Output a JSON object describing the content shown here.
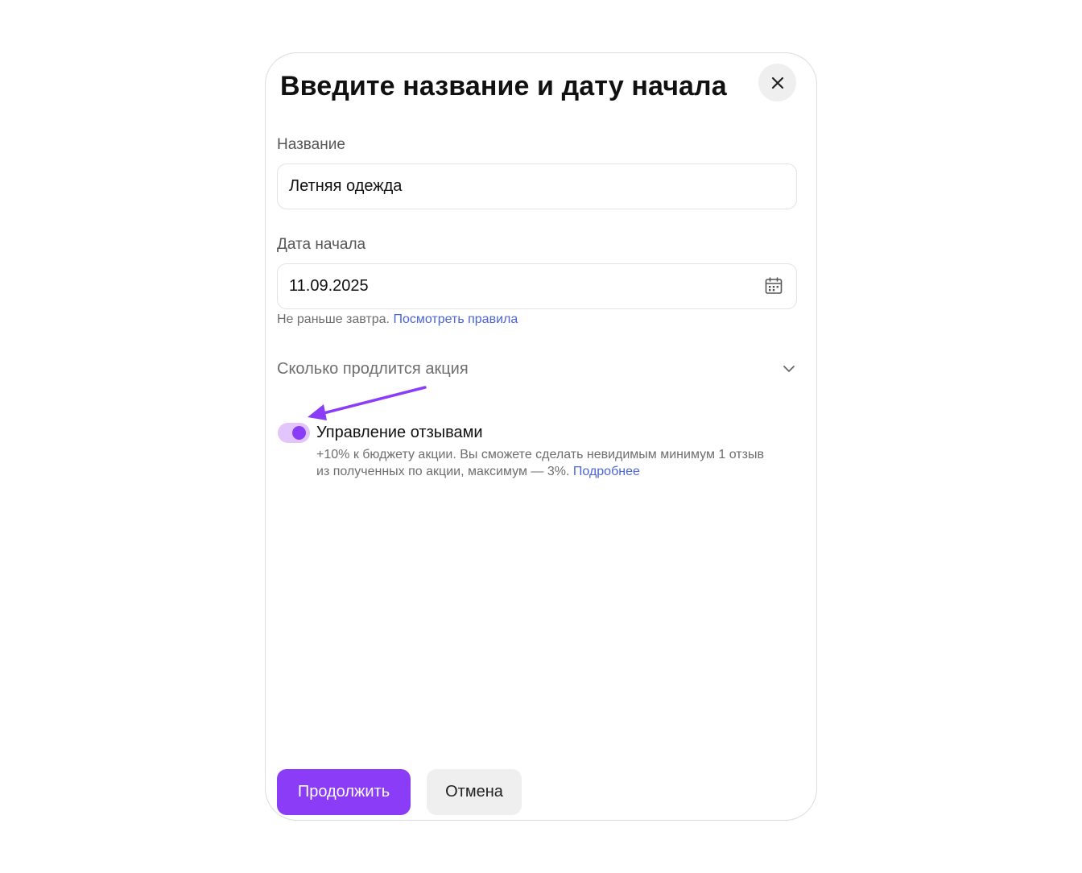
{
  "modal": {
    "title": "Введите название и дату начала",
    "close_icon": "close-icon"
  },
  "name_field": {
    "label": "Название",
    "value": "Летняя одежда"
  },
  "start_date_field": {
    "label": "Дата начала",
    "value": "11.09.2025",
    "icon": "calendar-icon",
    "hint": "Не раньше завтра.",
    "hint_link": "Посмотреть правила"
  },
  "duration": {
    "label": "Сколько продлится акция",
    "icon": "chevron-down-icon"
  },
  "review_toggle": {
    "title": "Управление отзывами",
    "state": "on",
    "description": "+10% к бюджету акции. Вы сможете сделать невидимым минимум 1 отзыв из полученных по акции, максимум — 3%.",
    "link": "Подробнее"
  },
  "annotation": {
    "icon": "arrow-annotation",
    "color": "#8b3cf7"
  },
  "buttons": {
    "continue": "Продолжить",
    "cancel": "Отмена"
  },
  "colors": {
    "accent": "#8b3cf7",
    "toggle_track": "#e2c5fb",
    "link": "#4b64d6"
  }
}
